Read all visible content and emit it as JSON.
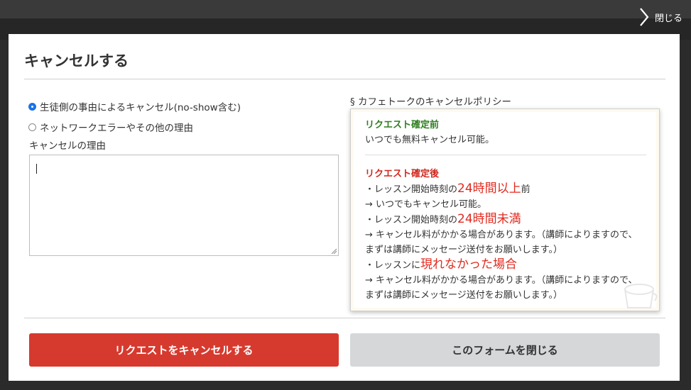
{
  "header": {
    "close_label": "閉じる"
  },
  "modal": {
    "title": "キャンセルする",
    "options": [
      {
        "label": "生徒側の事由によるキャンセル(no-show含む)",
        "checked": true
      },
      {
        "label": "ネットワークエラーやその他の理由",
        "checked": false
      }
    ],
    "reason_label": "キャンセルの理由",
    "reason_value": ""
  },
  "policy": {
    "heading": "§  カフェトークのキャンセルポリシー",
    "before_title": "リクエスト確定前",
    "before_text": "いつでも無料キャンセル可能。",
    "after_title": "リクエスト確定後",
    "line1_pre": "・レッスン開始時刻の",
    "line1_em": "24時間以上",
    "line1_post": "前",
    "line2": " → いつでもキャンセル可能。",
    "line3_pre": "・レッスン開始時刻の",
    "line3_em": "24時間未満",
    "line4": " → キャンセル料がかかる場合があります。（講師によりますので、まずは講師にメッセージ送付をお願いします。）",
    "line5_pre": "・レッスンに",
    "line5_em": "現れなかった場合",
    "line6": "→ キャンセル料がかかる場合があります。（講師によりますので、まずは講師にメッセージ送付をお願いします。）"
  },
  "buttons": {
    "cancel_request": "リクエストをキャンセルする",
    "close_form": "このフォームを閉じる"
  },
  "colors": {
    "cancel_button": "#d63a2f",
    "close_button": "#d5d7d9",
    "green_heading": "#2e7d1e",
    "red_heading": "#d0271d",
    "radio_checked": "#1a73e8"
  }
}
